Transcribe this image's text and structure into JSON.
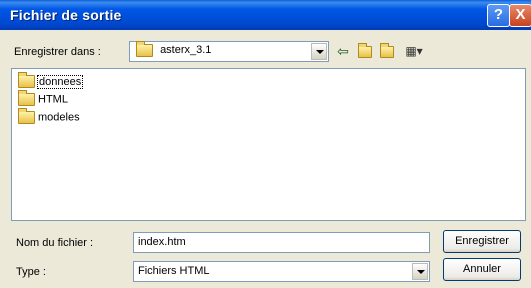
{
  "window": {
    "title": "Fichier de sortie",
    "help_label": "?",
    "close_label": "X"
  },
  "save_in": {
    "label": "Enregistrer dans :",
    "value": "asterx_3.1"
  },
  "toolbar": {
    "back_icon": "arrow-left-icon",
    "up_icon": "folder-up-icon",
    "new_folder_icon": "new-folder-icon",
    "view_icon": "view-menu-icon"
  },
  "files": [
    {
      "name": "donnees",
      "selected": true
    },
    {
      "name": "HTML",
      "selected": false
    },
    {
      "name": "modeles",
      "selected": false
    }
  ],
  "filename": {
    "label": "Nom du fichier :",
    "value": "index.htm"
  },
  "filetype": {
    "label": "Type :",
    "value": "Fichiers HTML"
  },
  "buttons": {
    "save": "Enregistrer",
    "cancel": "Annuler"
  },
  "colors": {
    "titlebar": "#0058e6",
    "dialog_bg": "#ece9d8",
    "field_border": "#7f9db9"
  }
}
